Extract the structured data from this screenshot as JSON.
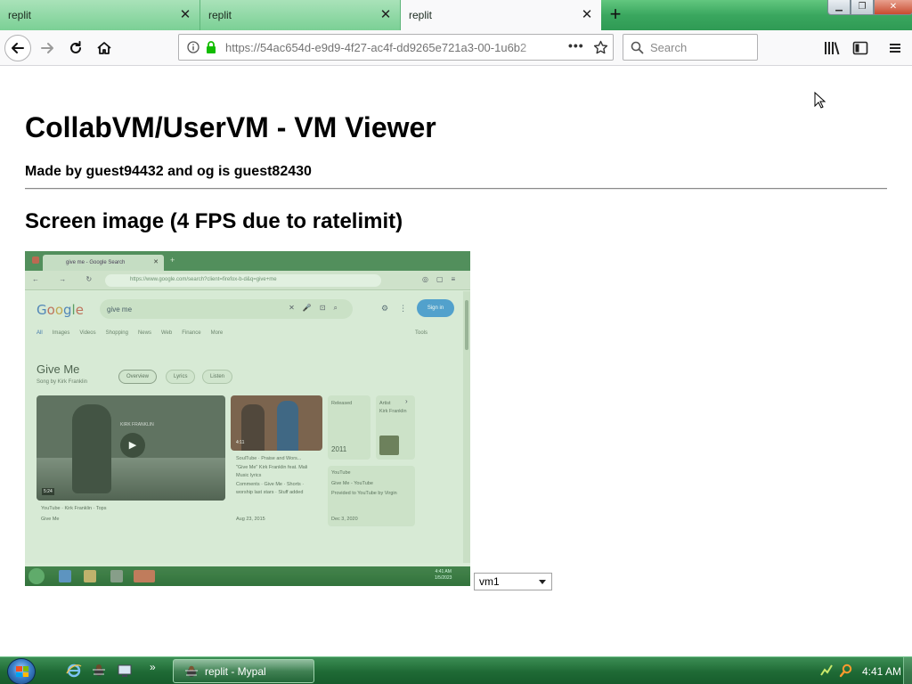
{
  "browser": {
    "tabs": [
      {
        "label": "replit",
        "state": "inactive"
      },
      {
        "label": "replit",
        "state": "inactive"
      },
      {
        "label": "replit",
        "state": "active"
      }
    ],
    "url": "https://54ac654d-e9d9-4f27-ac4f-dd9265e721a3-00-1u6b2",
    "search_placeholder": "Search"
  },
  "page": {
    "title": "CollabVM/UserVM - VM Viewer",
    "credit": "Made by guest94432 and og is guest82430",
    "section_heading": "Screen image (4 FPS due to ratelimit)",
    "vm_select_value": "vm1"
  },
  "vm_screen": {
    "tab_title": "give me - Google Search",
    "url": "https://www.google.com/search?client=firefox-b-d&q=give+me",
    "search_query": "give me",
    "sign_in": "Sign in",
    "nav_tabs": [
      "All",
      "Images",
      "Videos",
      "Shopping",
      "News",
      "Web",
      "Finance",
      "More"
    ],
    "tools": "Tools",
    "knowledge_title": "Give Me",
    "knowledge_sub": "Song by Kirk Franklin",
    "chips": [
      "Overview",
      "Lyrics",
      "Listen"
    ],
    "video1_duration": "5:24",
    "video1_banner": "KIRK FRANKLIN",
    "video1_source": "YouTube · Kirk Franklin · Tops",
    "video1_title": "Give Me",
    "video2_duration": "4:11",
    "video2_source": "SoulTube · Praise and Wors...",
    "video2_title": "\"Give Me\" Kirk Franklin feat. Mali Music lyrics",
    "video2_desc": "Comments · Give Me · Shorts · worship last stars · Stuff added",
    "video2_date": "Aug 23, 2015",
    "released_label": "Released",
    "released_year": "2011",
    "artist_label": "Artist",
    "artist_name": "Kirk Franklin",
    "yt_source": "YouTube",
    "yt_title": "Give Me - YouTube",
    "yt_desc": "Provided to YouTube by Virgin",
    "yt_date": "Dec 3, 2020",
    "clock_time": "4:41 AM",
    "clock_date": "1/5/2023"
  },
  "taskbar": {
    "task_label": "replit - Mypal",
    "clock": "4:41 AM"
  },
  "colors": {
    "tabstrip": "#3aa75f",
    "taskbar": "#1f6a35",
    "google_signin": "#4f9ed6"
  }
}
